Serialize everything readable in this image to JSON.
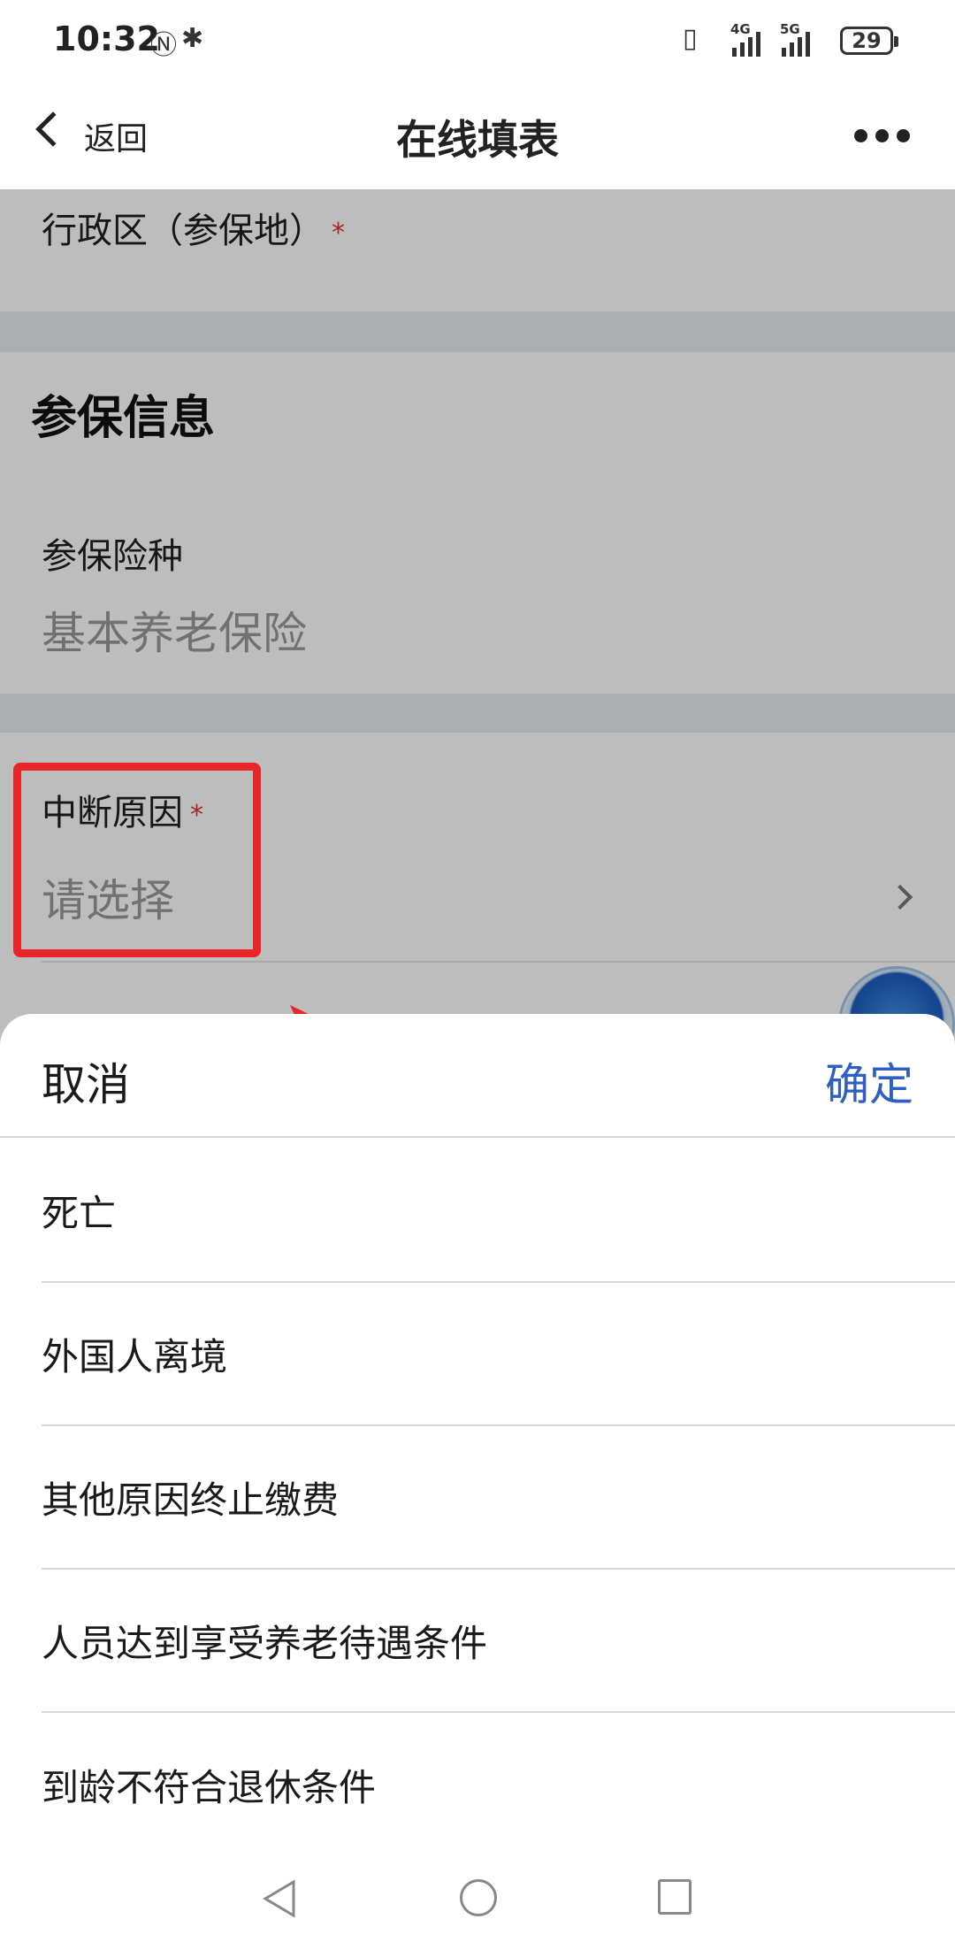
{
  "status_bar": {
    "time": "10:32",
    "nfc_icon": "nfc-icon",
    "bluetooth_icon": "bluetooth-icon",
    "vibrate_icon": "vibrate-icon",
    "signal1_tag": "4G",
    "signal2_tag": "5G",
    "battery": "29"
  },
  "nav": {
    "back_label": "返回",
    "title": "在线填表"
  },
  "form": {
    "admin_region_label": "行政区（参保地）",
    "required_mark": "*",
    "section_title": "参保信息",
    "insurance_type_label": "参保险种",
    "insurance_type_value": "基本养老保险",
    "interrupt_reason_label": "中断原因",
    "interrupt_reason_placeholder": "请选择"
  },
  "sheet": {
    "cancel_label": "取消",
    "confirm_label": "确定",
    "options": [
      "死亡",
      "外国人离境",
      "其他原因终止缴费",
      "人员达到享受养老待遇条件",
      "到龄不符合退休条件"
    ]
  },
  "colors": {
    "accent_blue": "#2f5fc4",
    "required_red": "#e0332a",
    "highlight_red": "#e8262a"
  }
}
